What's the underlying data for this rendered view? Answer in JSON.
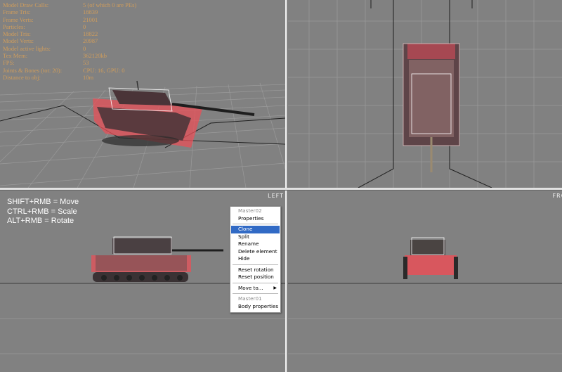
{
  "stats": [
    {
      "label": "Model Draw Calls:",
      "value": "5 (of which 0 are PEs)"
    },
    {
      "label": "Frame Tris:",
      "value": "18839"
    },
    {
      "label": "Frame Verts:",
      "value": "21001"
    },
    {
      "label": "Particles:",
      "value": "0"
    },
    {
      "label": "Model Tris:",
      "value": "18822"
    },
    {
      "label": "Model Verts:",
      "value": "20987"
    },
    {
      "label": "Model active lights:",
      "value": "0"
    },
    {
      "label": "Tex Mem:",
      "value": "362120kb"
    },
    {
      "label": "FPS:",
      "value": "53"
    },
    {
      "label": "Joints & Bones (tot: 20):",
      "value": "CPU: 16, GPU: 0"
    },
    {
      "label": "Distance to obj:",
      "value": "10m"
    }
  ],
  "viewports": {
    "left_label": "LEFT",
    "front_label": "FRO"
  },
  "hints": [
    "SHIFT+RMB = Move",
    "CTRL+RMB = Scale",
    "ALT+RMB = Rotate"
  ],
  "context_menu": {
    "header1": "Master02",
    "properties": "Properties",
    "clone": "Clone",
    "split": "Split",
    "rename": "Rename",
    "delete": "Delete element",
    "hide": "Hide",
    "reset_rotation": "Reset rotation",
    "reset_position": "Reset position",
    "move_to": "Move to...",
    "header2": "Master01",
    "body_properties": "Body properties",
    "submenu_arrow": "▶"
  },
  "colors": {
    "viewport_bg": "#818181",
    "stats_text": "#d8a058",
    "selection_red": "#e85058",
    "menu_highlight": "#316ac5"
  }
}
